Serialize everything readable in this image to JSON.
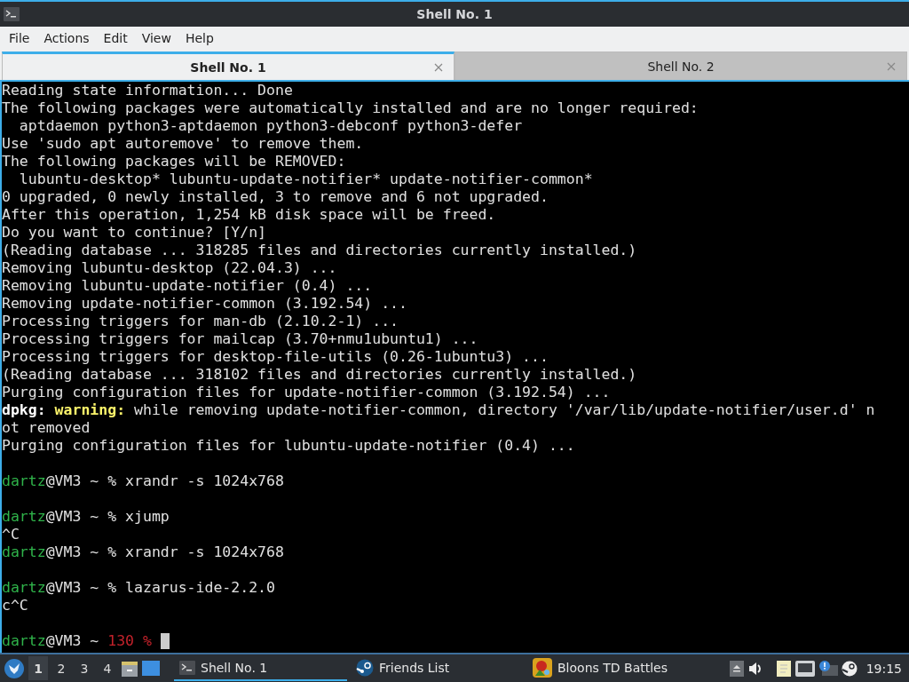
{
  "window": {
    "title": "Shell No. 1"
  },
  "menu": [
    "File",
    "Actions",
    "Edit",
    "View",
    "Help"
  ],
  "tabs": [
    {
      "label": "Shell No. 1",
      "selected": true
    },
    {
      "label": "Shell No. 2",
      "selected": false
    }
  ],
  "terminal": {
    "lines": [
      {
        "kind": "text",
        "segments": [
          {
            "kind": "plain",
            "text": "Reading state information... Done"
          }
        ]
      },
      {
        "kind": "text",
        "segments": [
          {
            "kind": "plain",
            "text": "The following packages were automatically installed and are no longer required:"
          }
        ]
      },
      {
        "kind": "text",
        "segments": [
          {
            "kind": "plain",
            "text": "  aptdaemon python3-aptdaemon python3-debconf python3-defer"
          }
        ]
      },
      {
        "kind": "text",
        "segments": [
          {
            "kind": "plain",
            "text": "Use 'sudo apt autoremove' to remove them."
          }
        ]
      },
      {
        "kind": "text",
        "segments": [
          {
            "kind": "plain",
            "text": "The following packages will be REMOVED:"
          }
        ]
      },
      {
        "kind": "text",
        "segments": [
          {
            "kind": "plain",
            "text": "  lubuntu-desktop* lubuntu-update-notifier* update-notifier-common*"
          }
        ]
      },
      {
        "kind": "text",
        "segments": [
          {
            "kind": "plain",
            "text": "0 upgraded, 0 newly installed, 3 to remove and 6 not upgraded."
          }
        ]
      },
      {
        "kind": "text",
        "segments": [
          {
            "kind": "plain",
            "text": "After this operation, 1,254 kB disk space will be freed."
          }
        ]
      },
      {
        "kind": "text",
        "segments": [
          {
            "kind": "plain",
            "text": "Do you want to continue? [Y/n]"
          }
        ]
      },
      {
        "kind": "text",
        "segments": [
          {
            "kind": "plain",
            "text": "(Reading database ... 318285 files and directories currently installed.)"
          }
        ]
      },
      {
        "kind": "text",
        "segments": [
          {
            "kind": "plain",
            "text": "Removing lubuntu-desktop (22.04.3) ..."
          }
        ]
      },
      {
        "kind": "text",
        "segments": [
          {
            "kind": "plain",
            "text": "Removing lubuntu-update-notifier (0.4) ..."
          }
        ]
      },
      {
        "kind": "text",
        "segments": [
          {
            "kind": "plain",
            "text": "Removing update-notifier-common (3.192.54) ..."
          }
        ]
      },
      {
        "kind": "text",
        "segments": [
          {
            "kind": "plain",
            "text": "Processing triggers for man-db (2.10.2-1) ..."
          }
        ]
      },
      {
        "kind": "text",
        "segments": [
          {
            "kind": "plain",
            "text": "Processing triggers for mailcap (3.70+nmu1ubuntu1) ..."
          }
        ]
      },
      {
        "kind": "text",
        "segments": [
          {
            "kind": "plain",
            "text": "Processing triggers for desktop-file-utils (0.26-1ubuntu3) ..."
          }
        ]
      },
      {
        "kind": "text",
        "segments": [
          {
            "kind": "plain",
            "text": "(Reading database ... 318102 files and directories currently installed.)"
          }
        ]
      },
      {
        "kind": "text",
        "segments": [
          {
            "kind": "plain",
            "text": "Purging configuration files for update-notifier-common (3.192.54) ..."
          }
        ]
      },
      {
        "kind": "text",
        "segments": [
          {
            "kind": "bold",
            "text": "dpkg: "
          },
          {
            "kind": "warning",
            "text": "warning:"
          },
          {
            "kind": "plain",
            "text": " while removing update-notifier-common, directory '/var/lib/update-notifier/user.d' n"
          }
        ]
      },
      {
        "kind": "text",
        "segments": [
          {
            "kind": "plain",
            "text": "ot removed"
          }
        ]
      },
      {
        "kind": "text",
        "segments": [
          {
            "kind": "plain",
            "text": "Purging configuration files for lubuntu-update-notifier (0.4) ..."
          }
        ]
      },
      {
        "kind": "blank"
      },
      {
        "kind": "text",
        "segments": [
          {
            "kind": "user",
            "text": "dartz"
          },
          {
            "kind": "plain",
            "text": "@VM3 ~ % xrandr -s 1024x768"
          }
        ]
      },
      {
        "kind": "blank"
      },
      {
        "kind": "text",
        "segments": [
          {
            "kind": "user",
            "text": "dartz"
          },
          {
            "kind": "plain",
            "text": "@VM3 ~ % xjump"
          }
        ]
      },
      {
        "kind": "text",
        "segments": [
          {
            "kind": "plain",
            "text": "^C"
          }
        ]
      },
      {
        "kind": "text",
        "segments": [
          {
            "kind": "user",
            "text": "dartz"
          },
          {
            "kind": "plain",
            "text": "@VM3 ~ % xrandr -s 1024x768"
          }
        ]
      },
      {
        "kind": "blank"
      },
      {
        "kind": "text",
        "segments": [
          {
            "kind": "user",
            "text": "dartz"
          },
          {
            "kind": "plain",
            "text": "@VM3 ~ % lazarus-ide-2.2.0"
          }
        ]
      },
      {
        "kind": "text",
        "segments": [
          {
            "kind": "plain",
            "text": "c^C"
          }
        ]
      },
      {
        "kind": "blank"
      },
      {
        "kind": "text",
        "cursor": true,
        "segments": [
          {
            "kind": "user",
            "text": "dartz"
          },
          {
            "kind": "plain",
            "text": "@VM3 ~ "
          },
          {
            "kind": "error",
            "text": "130 %"
          }
        ]
      }
    ]
  },
  "taskbar": {
    "desktops": [
      {
        "label": "1",
        "selected": true
      },
      {
        "label": "2",
        "selected": false
      },
      {
        "label": "3",
        "selected": false
      },
      {
        "label": "4",
        "selected": false
      }
    ],
    "tasks": [
      {
        "label": "Shell No. 1",
        "kind": "terminal",
        "selected": true
      },
      {
        "label": "Friends List",
        "kind": "steam",
        "selected": false
      },
      {
        "label": "Bloons TD Battles",
        "kind": "game",
        "selected": false
      }
    ],
    "clock": "19:15"
  }
}
